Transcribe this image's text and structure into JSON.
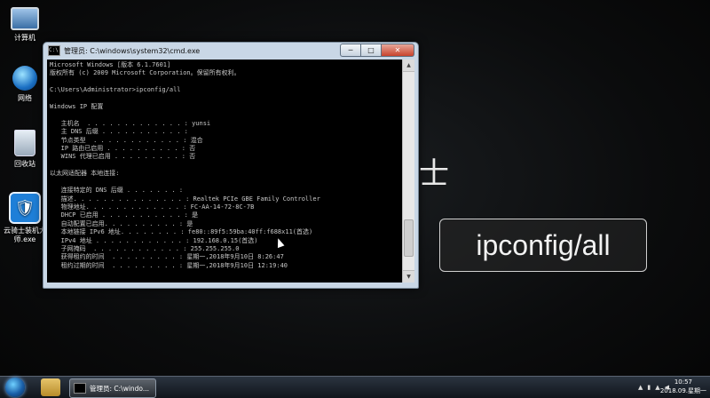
{
  "desktop": {
    "icons": [
      {
        "label": "计算机",
        "icon": "computer-icon"
      },
      {
        "label": "网络",
        "icon": "network-icon"
      },
      {
        "label": "回收站",
        "icon": "recycle-bin-icon"
      },
      {
        "label": "云骑士装机大师.exe",
        "icon": "app-icon"
      }
    ]
  },
  "window": {
    "title": "管理员: C:\\windows\\system32\\cmd.exe",
    "buttons": {
      "minimize": "─",
      "maximize": "□",
      "close": "✕"
    }
  },
  "console": {
    "lines": [
      "Microsoft Windows [版本 6.1.7601]",
      "版权所有 (c) 2009 Microsoft Corporation。保留所有权利。",
      "",
      "C:\\Users\\Administrator>ipconfig/all",
      "",
      "Windows IP 配置",
      "",
      "   主机名  . . . . . . . . . . . . . : yunsi",
      "   主 DNS 后缀 . . . . . . . . . . . :",
      "   节点类型  . . . . . . . . . . . . : 混合",
      "   IP 路由已启用 . . . . . . . . . . : 否",
      "   WINS 代理已启用 . . . . . . . . . : 否",
      "",
      "以太网适配器 本地连接:",
      "",
      "   连接特定的 DNS 后缀 . . . . . . . :",
      "   描述. . . . . . . . . . . . . . . : Realtek PCIe GBE Family Controller",
      "   物理地址. . . . . . . . . . . . . : FC-AA-14-72-8C-7B",
      "   DHCP 已启用 . . . . . . . . . . . : 是",
      "   自动配置已启用. . . . . . . . . . : 是",
      "   本地链接 IPv6 地址. . . . . . . . : fe80::89f5:59ba:40ff:f688x11(首选)",
      "   IPv4 地址 . . . . . . . . . . . . : 192.168.0.15(首选)",
      "   子网掩码  . . . . . . . . . . . . : 255.255.255.0",
      "   获得租约的时间  . . . . . . . . . : 星期一,2018年9月10日 8:26:47",
      "   租约过期的时间  . . . . . . . . . : 星期一,2018年9月10日 12:19:40"
    ]
  },
  "overlay": {
    "big_char": "士",
    "caption": "ipconfig/all"
  },
  "taskbar": {
    "cmd_label": "管理员: C:\\windo...",
    "tray_icons": [
      "▲",
      "▮",
      "▲",
      "◀"
    ],
    "time": "10:57",
    "date": "2018.09.星期一"
  }
}
